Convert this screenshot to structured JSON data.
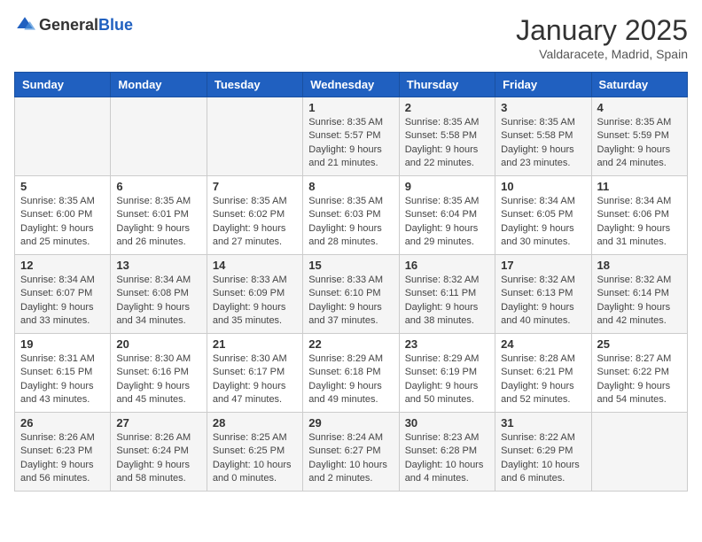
{
  "logo": {
    "general": "General",
    "blue": "Blue"
  },
  "calendar": {
    "title": "January 2025",
    "subtitle": "Valdaracete, Madrid, Spain"
  },
  "days": [
    "Sunday",
    "Monday",
    "Tuesday",
    "Wednesday",
    "Thursday",
    "Friday",
    "Saturday"
  ],
  "weeks": [
    [
      {
        "day": "",
        "text": ""
      },
      {
        "day": "",
        "text": ""
      },
      {
        "day": "",
        "text": ""
      },
      {
        "day": "1",
        "text": "Sunrise: 8:35 AM\nSunset: 5:57 PM\nDaylight: 9 hours and 21 minutes."
      },
      {
        "day": "2",
        "text": "Sunrise: 8:35 AM\nSunset: 5:58 PM\nDaylight: 9 hours and 22 minutes."
      },
      {
        "day": "3",
        "text": "Sunrise: 8:35 AM\nSunset: 5:58 PM\nDaylight: 9 hours and 23 minutes."
      },
      {
        "day": "4",
        "text": "Sunrise: 8:35 AM\nSunset: 5:59 PM\nDaylight: 9 hours and 24 minutes."
      }
    ],
    [
      {
        "day": "5",
        "text": "Sunrise: 8:35 AM\nSunset: 6:00 PM\nDaylight: 9 hours and 25 minutes."
      },
      {
        "day": "6",
        "text": "Sunrise: 8:35 AM\nSunset: 6:01 PM\nDaylight: 9 hours and 26 minutes."
      },
      {
        "day": "7",
        "text": "Sunrise: 8:35 AM\nSunset: 6:02 PM\nDaylight: 9 hours and 27 minutes."
      },
      {
        "day": "8",
        "text": "Sunrise: 8:35 AM\nSunset: 6:03 PM\nDaylight: 9 hours and 28 minutes."
      },
      {
        "day": "9",
        "text": "Sunrise: 8:35 AM\nSunset: 6:04 PM\nDaylight: 9 hours and 29 minutes."
      },
      {
        "day": "10",
        "text": "Sunrise: 8:34 AM\nSunset: 6:05 PM\nDaylight: 9 hours and 30 minutes."
      },
      {
        "day": "11",
        "text": "Sunrise: 8:34 AM\nSunset: 6:06 PM\nDaylight: 9 hours and 31 minutes."
      }
    ],
    [
      {
        "day": "12",
        "text": "Sunrise: 8:34 AM\nSunset: 6:07 PM\nDaylight: 9 hours and 33 minutes."
      },
      {
        "day": "13",
        "text": "Sunrise: 8:34 AM\nSunset: 6:08 PM\nDaylight: 9 hours and 34 minutes."
      },
      {
        "day": "14",
        "text": "Sunrise: 8:33 AM\nSunset: 6:09 PM\nDaylight: 9 hours and 35 minutes."
      },
      {
        "day": "15",
        "text": "Sunrise: 8:33 AM\nSunset: 6:10 PM\nDaylight: 9 hours and 37 minutes."
      },
      {
        "day": "16",
        "text": "Sunrise: 8:32 AM\nSunset: 6:11 PM\nDaylight: 9 hours and 38 minutes."
      },
      {
        "day": "17",
        "text": "Sunrise: 8:32 AM\nSunset: 6:13 PM\nDaylight: 9 hours and 40 minutes."
      },
      {
        "day": "18",
        "text": "Sunrise: 8:32 AM\nSunset: 6:14 PM\nDaylight: 9 hours and 42 minutes."
      }
    ],
    [
      {
        "day": "19",
        "text": "Sunrise: 8:31 AM\nSunset: 6:15 PM\nDaylight: 9 hours and 43 minutes."
      },
      {
        "day": "20",
        "text": "Sunrise: 8:30 AM\nSunset: 6:16 PM\nDaylight: 9 hours and 45 minutes."
      },
      {
        "day": "21",
        "text": "Sunrise: 8:30 AM\nSunset: 6:17 PM\nDaylight: 9 hours and 47 minutes."
      },
      {
        "day": "22",
        "text": "Sunrise: 8:29 AM\nSunset: 6:18 PM\nDaylight: 9 hours and 49 minutes."
      },
      {
        "day": "23",
        "text": "Sunrise: 8:29 AM\nSunset: 6:19 PM\nDaylight: 9 hours and 50 minutes."
      },
      {
        "day": "24",
        "text": "Sunrise: 8:28 AM\nSunset: 6:21 PM\nDaylight: 9 hours and 52 minutes."
      },
      {
        "day": "25",
        "text": "Sunrise: 8:27 AM\nSunset: 6:22 PM\nDaylight: 9 hours and 54 minutes."
      }
    ],
    [
      {
        "day": "26",
        "text": "Sunrise: 8:26 AM\nSunset: 6:23 PM\nDaylight: 9 hours and 56 minutes."
      },
      {
        "day": "27",
        "text": "Sunrise: 8:26 AM\nSunset: 6:24 PM\nDaylight: 9 hours and 58 minutes."
      },
      {
        "day": "28",
        "text": "Sunrise: 8:25 AM\nSunset: 6:25 PM\nDaylight: 10 hours and 0 minutes."
      },
      {
        "day": "29",
        "text": "Sunrise: 8:24 AM\nSunset: 6:27 PM\nDaylight: 10 hours and 2 minutes."
      },
      {
        "day": "30",
        "text": "Sunrise: 8:23 AM\nSunset: 6:28 PM\nDaylight: 10 hours and 4 minutes."
      },
      {
        "day": "31",
        "text": "Sunrise: 8:22 AM\nSunset: 6:29 PM\nDaylight: 10 hours and 6 minutes."
      },
      {
        "day": "",
        "text": ""
      }
    ]
  ]
}
